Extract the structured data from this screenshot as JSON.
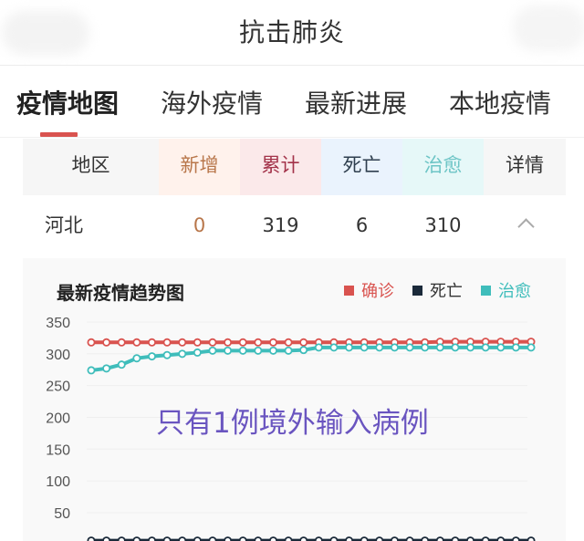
{
  "header": {
    "title": "抗击肺炎"
  },
  "tabs": [
    {
      "label": "疫情地图",
      "active": true
    },
    {
      "label": "海外疫情",
      "active": false
    },
    {
      "label": "最新进展",
      "active": false
    },
    {
      "label": "本地疫情",
      "active": false
    }
  ],
  "table": {
    "headers": [
      {
        "label": "地区",
        "color": "#333333",
        "bg": "#f6f6f6"
      },
      {
        "label": "新增",
        "color": "#b8764a",
        "bg": "#fff2ec"
      },
      {
        "label": "累计",
        "color": "#a3334a",
        "bg": "#fbe9ea"
      },
      {
        "label": "死亡",
        "color": "#2e3e4e",
        "bg": "#eaf3fd"
      },
      {
        "label": "治愈",
        "color": "#6dc5c6",
        "bg": "#e6f8f8"
      },
      {
        "label": "详情",
        "color": "#333333",
        "bg": "#f6f6f6"
      }
    ],
    "rows": [
      {
        "region": "河北",
        "new": "0",
        "total": "319",
        "deaths": "6",
        "cured": "310",
        "expand_icon": "chevron-up-icon"
      }
    ]
  },
  "chart_data": {
    "type": "line",
    "title": "最新疫情趋势图",
    "annotation": "只有1例境外输入病例",
    "xlabel": "",
    "ylabel": "",
    "ylim": [
      0,
      350
    ],
    "yticks": [
      "350",
      "300",
      "250",
      "200",
      "150",
      "100",
      "50"
    ],
    "grid": true,
    "legend_position": "top-right",
    "x_count": 30,
    "series": [
      {
        "name": "确诊",
        "color": "#d9534f",
        "values": [
          318,
          318,
          318,
          318,
          318,
          318,
          318,
          318,
          318,
          318,
          318,
          318,
          318,
          318,
          318,
          318,
          318,
          318,
          318,
          318,
          318,
          318,
          318,
          319,
          319,
          319,
          319,
          319,
          319,
          319
        ]
      },
      {
        "name": "死亡",
        "color": "#1b2a3a",
        "values": [
          6,
          6,
          6,
          6,
          6,
          6,
          6,
          6,
          6,
          6,
          6,
          6,
          6,
          6,
          6,
          6,
          6,
          6,
          6,
          6,
          6,
          6,
          6,
          6,
          6,
          6,
          6,
          6,
          6,
          6
        ]
      },
      {
        "name": "治愈",
        "color": "#3fbdbb",
        "values": [
          274,
          277,
          283,
          293,
          296,
          298,
          300,
          302,
          305,
          305,
          305,
          305,
          305,
          305,
          306,
          310,
          310,
          310,
          310,
          310,
          310,
          310,
          310,
          310,
          310,
          310,
          310,
          310,
          310,
          310
        ]
      }
    ]
  }
}
